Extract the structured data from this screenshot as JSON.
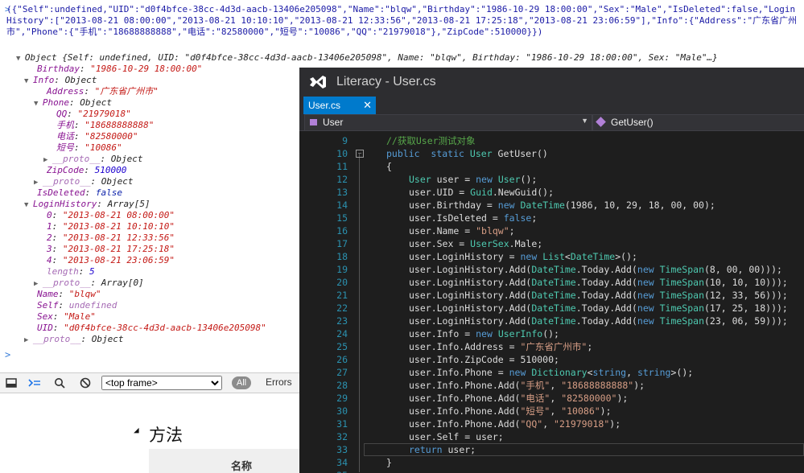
{
  "console": {
    "raw_json": "({\"Self\":undefined,\"UID\":\"d0f4bfce-38cc-4d3d-aacb-13406e205098\",\"Name\":\"blqw\",\"Birthday\":\"1986-10-29 18:00:00\",\"Sex\":\"Male\",\"IsDeleted\":false,\"LoginHistory\":[\"2013-08-21 08:00:00\",\"2013-08-21 10:10:10\",\"2013-08-21 12:33:56\",\"2013-08-21 17:25:18\",\"2013-08-21 23:06:59\"],\"Info\":{\"Address\":\"广东省广州市\",\"Phone\":{\"手机\":\"18688888888\",\"电话\":\"82580000\",\"短号\":\"10086\",\"QQ\":\"21979018\"},\"ZipCode\":510000}})",
    "summary": "Object {Self: undefined, UID: \"d0f4bfce-38cc-4d3d-aacb-13406e205098\", Name: \"blqw\", Birthday: \"1986-10-29 18:00:00\", Sex: \"Male\"…}",
    "tree": [
      {
        "indent": 1,
        "tri": "",
        "key": "Birthday",
        "sep": ": ",
        "val": "\"1986-10-29 18:00:00\"",
        "vt": "s"
      },
      {
        "indent": 1,
        "tri": "▼",
        "key": "Info",
        "sep": ": ",
        "val": "Object",
        "vt": "o"
      },
      {
        "indent": 2,
        "tri": "",
        "key": "Address",
        "sep": ": ",
        "val": "\"广东省广州市\"",
        "vt": "s"
      },
      {
        "indent": 2,
        "tri": "▼",
        "key": "Phone",
        "sep": ": ",
        "val": "Object",
        "vt": "o"
      },
      {
        "indent": 3,
        "tri": "",
        "key": "QQ",
        "sep": ": ",
        "val": "\"21979018\"",
        "vt": "s"
      },
      {
        "indent": 3,
        "tri": "",
        "key": "手机",
        "sep": ": ",
        "val": "\"18688888888\"",
        "vt": "s"
      },
      {
        "indent": 3,
        "tri": "",
        "key": "电话",
        "sep": ": ",
        "val": "\"82580000\"",
        "vt": "s"
      },
      {
        "indent": 3,
        "tri": "",
        "key": "短号",
        "sep": ": ",
        "val": "\"10086\"",
        "vt": "s"
      },
      {
        "indent": 3,
        "tri": "▶",
        "key": "__proto__",
        "sep": ": ",
        "val": "Object",
        "vt": "o",
        "dim": true
      },
      {
        "indent": 2,
        "tri": "",
        "key": "ZipCode",
        "sep": ": ",
        "val": "510000",
        "vt": "n"
      },
      {
        "indent": 2,
        "tri": "▶",
        "key": "__proto__",
        "sep": ": ",
        "val": "Object",
        "vt": "o",
        "dim": true
      },
      {
        "indent": 1,
        "tri": "",
        "key": "IsDeleted",
        "sep": ": ",
        "val": "false",
        "vt": "b"
      },
      {
        "indent": 1,
        "tri": "▼",
        "key": "LoginHistory",
        "sep": ": ",
        "val": "Array[5]",
        "vt": "o"
      },
      {
        "indent": 2,
        "tri": "",
        "key": "0",
        "sep": ": ",
        "val": "\"2013-08-21 08:00:00\"",
        "vt": "s"
      },
      {
        "indent": 2,
        "tri": "",
        "key": "1",
        "sep": ": ",
        "val": "\"2013-08-21 10:10:10\"",
        "vt": "s"
      },
      {
        "indent": 2,
        "tri": "",
        "key": "2",
        "sep": ": ",
        "val": "\"2013-08-21 12:33:56\"",
        "vt": "s"
      },
      {
        "indent": 2,
        "tri": "",
        "key": "3",
        "sep": ": ",
        "val": "\"2013-08-21 17:25:18\"",
        "vt": "s"
      },
      {
        "indent": 2,
        "tri": "",
        "key": "4",
        "sep": ": ",
        "val": "\"2013-08-21 23:06:59\"",
        "vt": "s"
      },
      {
        "indent": 2,
        "tri": "",
        "key": "length",
        "sep": ": ",
        "val": "5",
        "vt": "n",
        "dim": true
      },
      {
        "indent": 2,
        "tri": "▶",
        "key": "__proto__",
        "sep": ": ",
        "val": "Array[0]",
        "vt": "o",
        "dim": true
      },
      {
        "indent": 1,
        "tri": "",
        "key": "Name",
        "sep": ": ",
        "val": "\"blqw\"",
        "vt": "s"
      },
      {
        "indent": 1,
        "tri": "",
        "key": "Self",
        "sep": ": ",
        "val": "undefined",
        "vt": "u"
      },
      {
        "indent": 1,
        "tri": "",
        "key": "Sex",
        "sep": ": ",
        "val": "\"Male\"",
        "vt": "s"
      },
      {
        "indent": 1,
        "tri": "",
        "key": "UID",
        "sep": ": ",
        "val": "\"d0f4bfce-38cc-4d3d-aacb-13406e205098\"",
        "vt": "s"
      },
      {
        "indent": 1,
        "tri": "▶",
        "key": "__proto__",
        "sep": ": ",
        "val": "Object",
        "vt": "o",
        "dim": true
      }
    ]
  },
  "devtools_toolbar": {
    "frame_select": "<top frame>",
    "all_label": "All",
    "errors_label": "Errors"
  },
  "page": {
    "method_title": "方法",
    "table_header": "名称"
  },
  "vs": {
    "title": "Literacy - User.cs",
    "tab_label": "User.cs",
    "tab_close": "✕",
    "nav_left": "User",
    "nav_right": "GetUser()",
    "lines": [
      {
        "n": "9",
        "tokens": [
          [
            "cm",
            "//获取User测试对象"
          ]
        ],
        "indent": 1
      },
      {
        "n": "10",
        "tokens": [
          [
            "kw",
            "public"
          ],
          [
            "",
            "  "
          ],
          [
            "kw",
            "static"
          ],
          [
            "",
            " "
          ],
          [
            "ty",
            "User"
          ],
          [
            "",
            " GetUser()"
          ]
        ],
        "indent": 1,
        "fold": "−"
      },
      {
        "n": "11",
        "tokens": [
          [
            "",
            "{"
          ]
        ],
        "indent": 1
      },
      {
        "n": "12",
        "tokens": [
          [
            "ty",
            "User"
          ],
          [
            "",
            " user = "
          ],
          [
            "kw",
            "new"
          ],
          [
            "",
            " "
          ],
          [
            "ty",
            "User"
          ],
          [
            "",
            "();"
          ]
        ],
        "indent": 2
      },
      {
        "n": "13",
        "tokens": [
          [
            "",
            "user.UID = "
          ],
          [
            "ty",
            "Guid"
          ],
          [
            "",
            ".NewGuid();"
          ]
        ],
        "indent": 2
      },
      {
        "n": "14",
        "tokens": [
          [
            "",
            "user.Birthday = "
          ],
          [
            "kw",
            "new"
          ],
          [
            "",
            " "
          ],
          [
            "ty",
            "DateTime"
          ],
          [
            "",
            "(1986, 10, 29, 18, 00, 00);"
          ]
        ],
        "indent": 2
      },
      {
        "n": "15",
        "tokens": [
          [
            "",
            "user.IsDeleted = "
          ],
          [
            "kw",
            "false"
          ],
          [
            "",
            ";"
          ]
        ],
        "indent": 2
      },
      {
        "n": "16",
        "tokens": [
          [
            "",
            "user.Name = "
          ],
          [
            "st",
            "\"blqw\""
          ],
          [
            "",
            ";"
          ]
        ],
        "indent": 2
      },
      {
        "n": "17",
        "tokens": [
          [
            "",
            "user.Sex = "
          ],
          [
            "ty",
            "UserSex"
          ],
          [
            "",
            ".Male;"
          ]
        ],
        "indent": 2
      },
      {
        "n": "18",
        "tokens": [
          [
            "",
            "user.LoginHistory = "
          ],
          [
            "kw",
            "new"
          ],
          [
            "",
            " "
          ],
          [
            "ty",
            "List"
          ],
          [
            "",
            "<"
          ],
          [
            "ty",
            "DateTime"
          ],
          [
            "",
            ">();"
          ]
        ],
        "indent": 2
      },
      {
        "n": "19",
        "tokens": [
          [
            "",
            "user.LoginHistory.Add("
          ],
          [
            "ty",
            "DateTime"
          ],
          [
            "",
            ".Today.Add("
          ],
          [
            "kw",
            "new"
          ],
          [
            "",
            " "
          ],
          [
            "ty",
            "TimeSpan"
          ],
          [
            "",
            "(8, 00, 00)));"
          ]
        ],
        "indent": 2
      },
      {
        "n": "20",
        "tokens": [
          [
            "",
            "user.LoginHistory.Add("
          ],
          [
            "ty",
            "DateTime"
          ],
          [
            "",
            ".Today.Add("
          ],
          [
            "kw",
            "new"
          ],
          [
            "",
            " "
          ],
          [
            "ty",
            "TimeSpan"
          ],
          [
            "",
            "(10, 10, 10)));"
          ]
        ],
        "indent": 2
      },
      {
        "n": "21",
        "tokens": [
          [
            "",
            "user.LoginHistory.Add("
          ],
          [
            "ty",
            "DateTime"
          ],
          [
            "",
            ".Today.Add("
          ],
          [
            "kw",
            "new"
          ],
          [
            "",
            " "
          ],
          [
            "ty",
            "TimeSpan"
          ],
          [
            "",
            "(12, 33, 56)));"
          ]
        ],
        "indent": 2
      },
      {
        "n": "22",
        "tokens": [
          [
            "",
            "user.LoginHistory.Add("
          ],
          [
            "ty",
            "DateTime"
          ],
          [
            "",
            ".Today.Add("
          ],
          [
            "kw",
            "new"
          ],
          [
            "",
            " "
          ],
          [
            "ty",
            "TimeSpan"
          ],
          [
            "",
            "(17, 25, 18)));"
          ]
        ],
        "indent": 2
      },
      {
        "n": "23",
        "tokens": [
          [
            "",
            "user.LoginHistory.Add("
          ],
          [
            "ty",
            "DateTime"
          ],
          [
            "",
            ".Today.Add("
          ],
          [
            "kw",
            "new"
          ],
          [
            "",
            " "
          ],
          [
            "ty",
            "TimeSpan"
          ],
          [
            "",
            "(23, 06, 59)));"
          ]
        ],
        "indent": 2
      },
      {
        "n": "24",
        "tokens": [
          [
            "",
            "user.Info = "
          ],
          [
            "kw",
            "new"
          ],
          [
            "",
            " "
          ],
          [
            "ty",
            "UserInfo"
          ],
          [
            "",
            "();"
          ]
        ],
        "indent": 2
      },
      {
        "n": "25",
        "tokens": [
          [
            "",
            "user.Info.Address = "
          ],
          [
            "st",
            "\"广东省广州市\""
          ],
          [
            "",
            ";"
          ]
        ],
        "indent": 2
      },
      {
        "n": "26",
        "tokens": [
          [
            "",
            "user.Info.ZipCode = 510000;"
          ]
        ],
        "indent": 2
      },
      {
        "n": "27",
        "tokens": [
          [
            "",
            "user.Info.Phone = "
          ],
          [
            "kw",
            "new"
          ],
          [
            "",
            " "
          ],
          [
            "ty",
            "Dictionary"
          ],
          [
            "",
            "<"
          ],
          [
            "kw",
            "string"
          ],
          [
            "",
            ", "
          ],
          [
            "kw",
            "string"
          ],
          [
            "",
            ">();"
          ]
        ],
        "indent": 2
      },
      {
        "n": "28",
        "tokens": [
          [
            "",
            "user.Info.Phone.Add("
          ],
          [
            "st",
            "\"手机\""
          ],
          [
            "",
            ", "
          ],
          [
            "st",
            "\"18688888888\""
          ],
          [
            "",
            ");"
          ]
        ],
        "indent": 2
      },
      {
        "n": "29",
        "tokens": [
          [
            "",
            "user.Info.Phone.Add("
          ],
          [
            "st",
            "\"电话\""
          ],
          [
            "",
            ", "
          ],
          [
            "st",
            "\"82580000\""
          ],
          [
            "",
            ");"
          ]
        ],
        "indent": 2
      },
      {
        "n": "30",
        "tokens": [
          [
            "",
            "user.Info.Phone.Add("
          ],
          [
            "st",
            "\"短号\""
          ],
          [
            "",
            ", "
          ],
          [
            "st",
            "\"10086\""
          ],
          [
            "",
            ");"
          ]
        ],
        "indent": 2
      },
      {
        "n": "31",
        "tokens": [
          [
            "",
            "user.Info.Phone.Add("
          ],
          [
            "st",
            "\"QQ\""
          ],
          [
            "",
            ", "
          ],
          [
            "st",
            "\"21979018\""
          ],
          [
            "",
            ");"
          ]
        ],
        "indent": 2
      },
      {
        "n": "32",
        "tokens": [
          [
            "",
            "user.Self = user;"
          ]
        ],
        "indent": 2
      },
      {
        "n": "33",
        "tokens": [
          [
            "kw",
            "return"
          ],
          [
            "",
            " user;"
          ]
        ],
        "indent": 2,
        "current": true
      },
      {
        "n": "34",
        "tokens": [
          [
            "",
            "}"
          ]
        ],
        "indent": 1
      },
      {
        "n": "35",
        "tokens": [],
        "indent": 1
      }
    ]
  }
}
